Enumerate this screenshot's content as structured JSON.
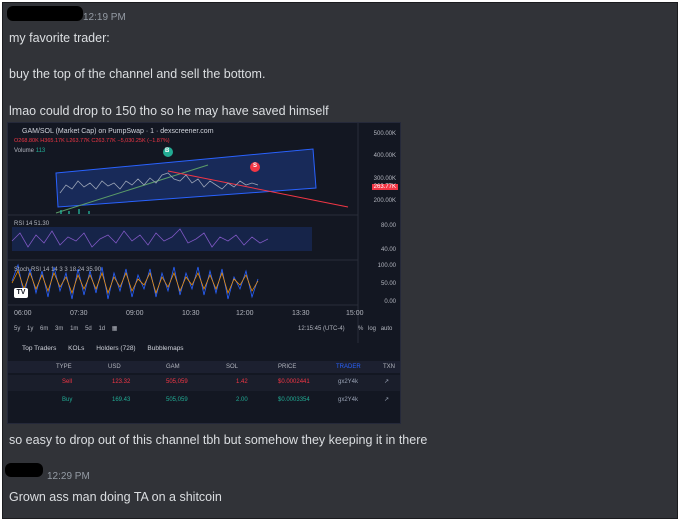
{
  "messages": [
    {
      "timestamp": "12:19 PM",
      "lines": [
        "my favorite trader:",
        "buy the top of the channel and sell the bottom.",
        "lmao could drop to 150 tho so he may have saved himself"
      ]
    },
    {
      "after_image": "so easy to drop out of this channel tbh but somehow they keeping it in there"
    },
    {
      "timestamp": "12:29 PM",
      "lines": [
        "Grown ass man doing TA on a shitcoin"
      ]
    }
  ],
  "chart": {
    "title": "GAM/SOL (Market Cap) on PumpSwap · 1 · dexscreener.com",
    "ohlc": "O268.80K H365.17K L263.77K C263.77K −5,030.25K (−1.87%)",
    "volume_label": "Volume",
    "volume_value": "113",
    "price_axis": [
      "500.00K",
      "400.00K",
      "300.00K",
      "263.77K",
      "200.00K"
    ],
    "rsi_label": "RSI 14 51.30",
    "rsi_axis": [
      "80.00",
      "40.00"
    ],
    "stoch_label": "Stoch RSI 14 14 3 3  18.24  35.90",
    "stoch_axis": [
      "100.00",
      "50.00",
      "0.00"
    ],
    "time_axis": [
      "06:00",
      "07:30",
      "09:00",
      "10:30",
      "12:00",
      "13:30",
      "15:00"
    ],
    "ranges": [
      "5y",
      "1y",
      "6m",
      "3m",
      "1m",
      "5d",
      "1d"
    ],
    "clock": "12:15:45 (UTC-4)",
    "scale": [
      "%",
      "log",
      "auto"
    ],
    "marker_buy": "B",
    "marker_sell": "S",
    "chart_data": {
      "type": "line",
      "series": [
        {
          "name": "",
          "values": [
            230,
            260,
            285,
            290,
            300,
            280,
            275,
            270,
            265,
            264
          ]
        }
      ]
    }
  },
  "tabs": [
    "Top Traders",
    "KOLs",
    "Holders (728)",
    "Bubblemaps"
  ],
  "table": {
    "headers": [
      "TYPE",
      "USD",
      "GAM",
      "SOL",
      "PRICE",
      "TRADER",
      "TXN"
    ],
    "rows": [
      {
        "type": "Sell",
        "usd": "123.32",
        "gam": "505,059",
        "sol": "1.42",
        "price": "$0.0002441",
        "trader": "gx2Y4k"
      },
      {
        "type": "Buy",
        "usd": "169.43",
        "gam": "505,059",
        "sol": "2.00",
        "price": "$0.0003354",
        "trader": "gx2Y4k"
      }
    ]
  },
  "colors": {
    "sell": "#f23645",
    "buy": "#22ab94",
    "channel": "#2962ff",
    "bg": "#313338"
  }
}
